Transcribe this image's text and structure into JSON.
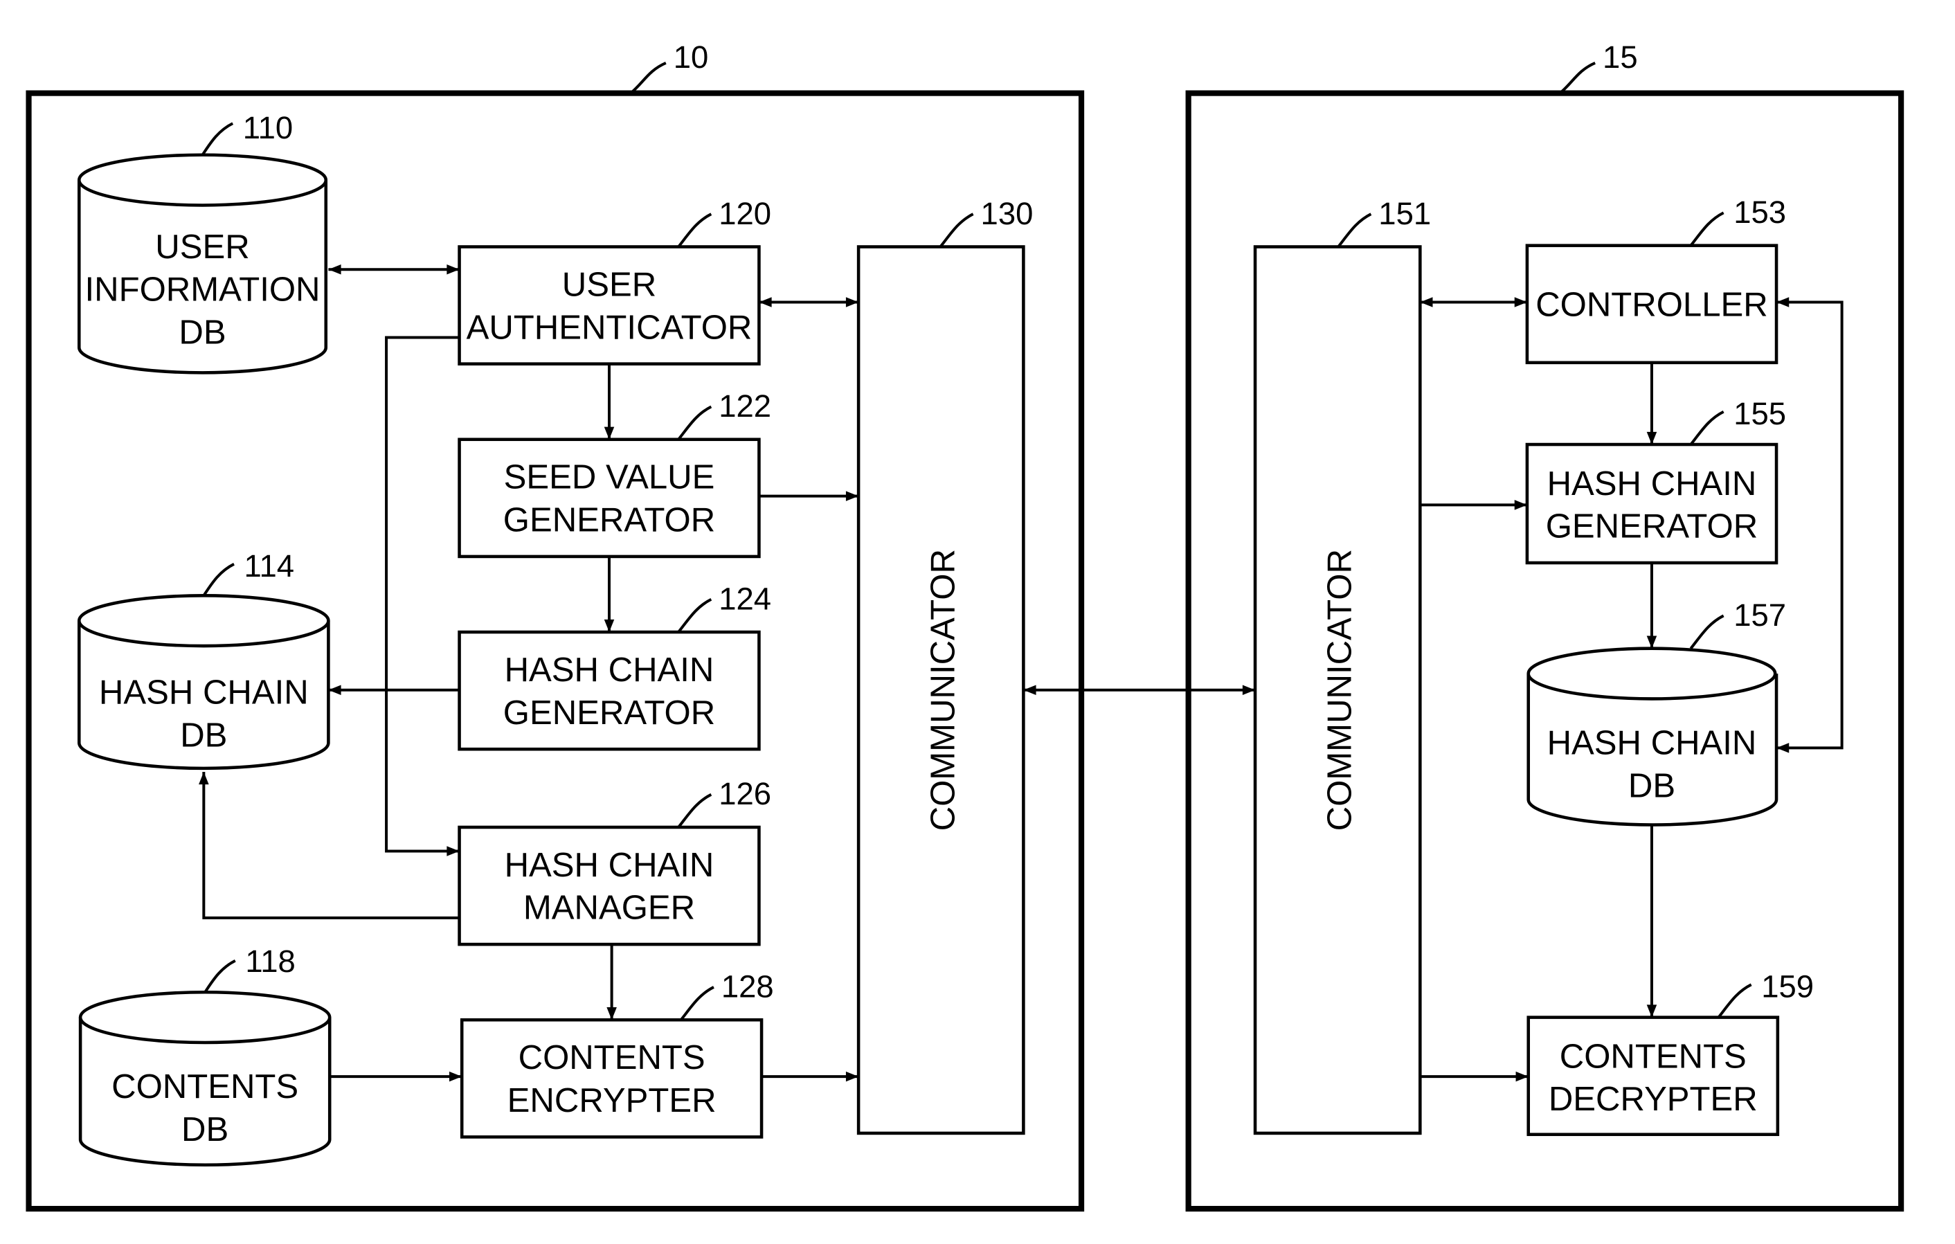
{
  "figure": {
    "server": {
      "ref": "10",
      "blocks": {
        "user_info_db": {
          "ref": "110",
          "lines": [
            "USER",
            "INFORMATION",
            "DB"
          ]
        },
        "user_authenticator": {
          "ref": "120",
          "lines": [
            "USER",
            "AUTHENTICATOR"
          ]
        },
        "seed_value_generator": {
          "ref": "122",
          "lines": [
            "SEED VALUE",
            "GENERATOR"
          ]
        },
        "hash_chain_generator": {
          "ref": "124",
          "lines": [
            "HASH CHAIN",
            "GENERATOR"
          ]
        },
        "hash_chain_manager": {
          "ref": "126",
          "lines": [
            "HASH CHAIN",
            "MANAGER"
          ]
        },
        "contents_encrypter": {
          "ref": "128",
          "lines": [
            "CONTENTS",
            "ENCRYPTER"
          ]
        },
        "hash_chain_db": {
          "ref": "114",
          "lines": [
            "HASH CHAIN",
            "DB"
          ]
        },
        "contents_db": {
          "ref": "118",
          "lines": [
            "CONTENTS",
            "DB"
          ]
        },
        "communicator": {
          "ref": "130",
          "label": "COMMUNICATOR"
        }
      }
    },
    "client": {
      "ref": "15",
      "blocks": {
        "communicator": {
          "ref": "151",
          "label": "COMMUNICATOR"
        },
        "controller": {
          "ref": "153",
          "lines": [
            "CONTROLLER"
          ]
        },
        "hash_chain_generator": {
          "ref": "155",
          "lines": [
            "HASH CHAIN",
            "GENERATOR"
          ]
        },
        "hash_chain_db": {
          "ref": "157",
          "lines": [
            "HASH CHAIN",
            "DB"
          ]
        },
        "contents_decrypter": {
          "ref": "159",
          "lines": [
            "CONTENTS",
            "DECRYPTER"
          ]
        }
      }
    }
  }
}
